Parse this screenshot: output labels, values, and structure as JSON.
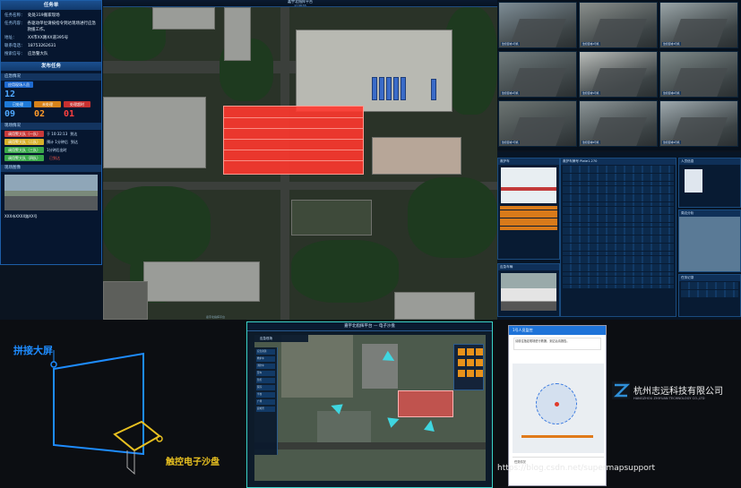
{
  "platform": {
    "title": "嘉宇北指挥平台",
    "time": "17:58:55"
  },
  "task_panel": {
    "title": "任务单",
    "fields": [
      {
        "k": "任务名称：",
        "v": "处处319搬家现场"
      },
      {
        "k": "任务内容：",
        "v": "各驱动单位请按指令到达现场进行应急救援工作。"
      },
      {
        "k": "地址：",
        "v": "XX市XX路XX道395号"
      },
      {
        "k": "联系电话：",
        "v": "18753262631"
      },
      {
        "k": "搜索信号：",
        "v": "应急警大队"
      }
    ],
    "dispatch_title": "发布任务",
    "stats_title": "应急情况",
    "stats_chip": "应用现场人员",
    "stats_value": "12",
    "stat_buttons": [
      "已处理",
      "未处理",
      "处理超时"
    ],
    "stat_counts": [
      "09",
      "02",
      "01"
    ],
    "site_title": "现场情况",
    "site_rows": [
      {
        "tag": "调用警大队（一队）",
        "time": "于 10:32:13",
        "state": "到达"
      },
      {
        "tag": "调用警大队（二队）",
        "time": "预计 1分钟后",
        "state": "到达"
      },
      {
        "tag": "调用警大队（三队）",
        "time": "1分钟后出时",
        "state": ""
      },
      {
        "tag": "调用警大队（四队）",
        "time": "",
        "state": "已到达"
      }
    ],
    "scene_title": "现场图像",
    "scene_caption": "XXX市XXXX路XX号"
  },
  "cameras": {
    "labels": [
      "监控区域1号机",
      "监控区域2号机",
      "监控区域3号机",
      "监控区域4号机",
      "监控区域5号机",
      "监控区域6号机",
      "监控区域7号机",
      "监控区域8号机",
      "监控区域9号机"
    ],
    "colors": [
      "#7d8c95",
      "#8a8f8c",
      "#9aa5a8",
      "#6f7a7c",
      "#b9bcb9",
      "#7f8a8a",
      "#6c7472",
      "#8b9496",
      "#9ea9ae"
    ]
  },
  "info_panels": {
    "vehicle_title": "救护车",
    "vehicle_plate": "救护车牌号 Plate1.270",
    "records_title": "任务记录",
    "person_title": "人员信息",
    "map_title": "周边分析",
    "badge": "应急车辆"
  },
  "bottom": {
    "wall_label": "拼接大屏",
    "sand_label": "触控电子沙盘",
    "sand_title": "嘉宇北指挥平台 — 电子沙盘",
    "sand_subtitle": "应急现场",
    "sand_list": [
      "应急资源",
      "救护车",
      "消防车",
      "警车",
      "监控",
      "医院",
      "学校",
      "广场",
      "避难所"
    ],
    "phone_title": "1号人员监控",
    "phone_msg": "请前往指定现场进行救援，到达后请报告。",
    "phone_footer": "任务情况",
    "company_cn": "杭州志远科技有限公司",
    "company_en": "HANGZHOU ZHIYUAN TECHNOLOGY CO.,LTD",
    "watermark": "https://blog.csdn.net/supermapsupport"
  },
  "colors": {
    "highlight_red": "#ff3b2f",
    "wall_blue": "#1e8cff",
    "sand_yellow": "#e8c020",
    "accent_orange": "#e8921a"
  }
}
